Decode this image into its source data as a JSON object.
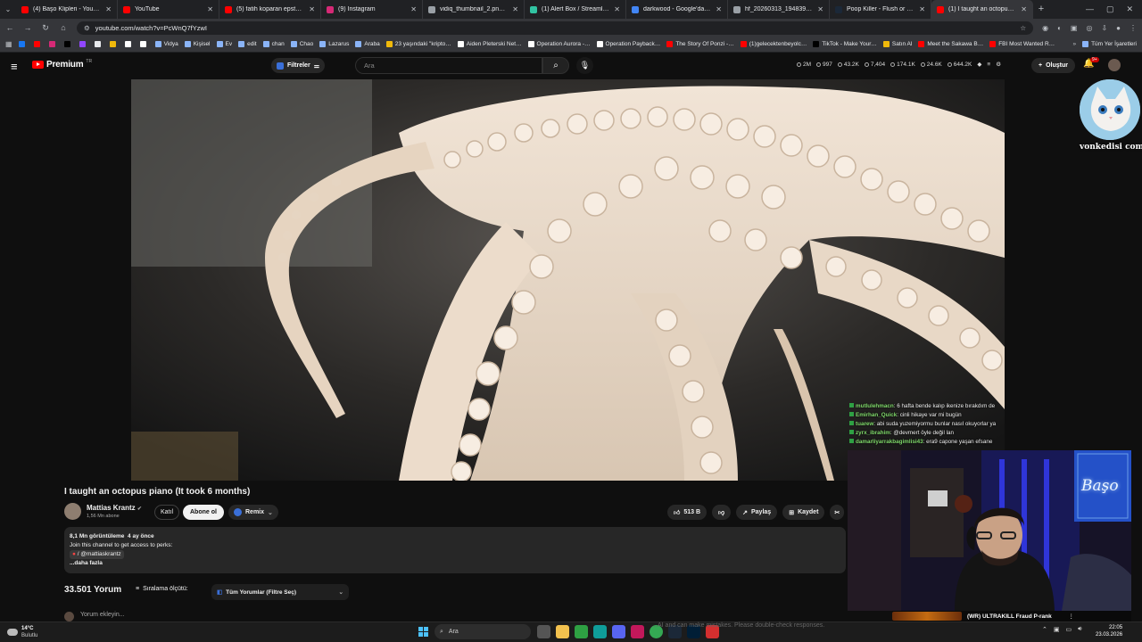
{
  "browser": {
    "tabs": [
      {
        "title": "(4) Başo Klipleri - YouTube",
        "color": "#ff0000"
      },
      {
        "title": "YouTube",
        "color": "#ff0000"
      },
      {
        "title": "(5) fatih koparan epstein adası",
        "color": "#ff0000"
      },
      {
        "title": "(9) Instagram",
        "color": "#d62976"
      },
      {
        "title": "vidiq_thumbnail_2.png (1280×…",
        "color": "#9aa0a6"
      },
      {
        "title": "(1) Alert Box / Streamlabs",
        "color": "#31c3a2"
      },
      {
        "title": "darkwood - Google'da Ara",
        "color": "#4285f4"
      },
      {
        "title": "hf_20260313_194839_41e0a9…",
        "color": "#9aa0a6"
      },
      {
        "title": "Poop Killer - Flush or Die Steam",
        "color": "#1b2838"
      },
      {
        "title": "(1) I taught an octopus piano",
        "color": "#ff0000"
      }
    ],
    "url": "youtube.com/watch?v=PcWnQ7fYzwI",
    "bookmarks": [
      {
        "label": "",
        "color": "#1877f2"
      },
      {
        "label": "",
        "color": "#ff0000"
      },
      {
        "label": "",
        "color": "#d62976"
      },
      {
        "label": "",
        "color": "#000000"
      },
      {
        "label": "",
        "color": "#9146ff"
      },
      {
        "label": "",
        "color": "#e8eaed"
      },
      {
        "label": "",
        "color": "#f0b90b"
      },
      {
        "label": "",
        "color": "#ffffff"
      },
      {
        "label": "",
        "color": "#ffffff"
      },
      {
        "label": "Vidya",
        "color": "#8ab4f8"
      },
      {
        "label": "Kişisel",
        "color": "#8ab4f8"
      },
      {
        "label": "Ev",
        "color": "#8ab4f8"
      },
      {
        "label": "edit",
        "color": "#8ab4f8"
      },
      {
        "label": "chan",
        "color": "#8ab4f8"
      },
      {
        "label": "Chao",
        "color": "#8ab4f8"
      },
      {
        "label": "Lazarus",
        "color": "#8ab4f8"
      },
      {
        "label": "Araba",
        "color": "#8ab4f8"
      },
      {
        "label": "23 yaşındaki \"kripto…",
        "color": "#f0b90b"
      },
      {
        "label": "Aiden Pleterski Net…",
        "color": "#ffffff"
      },
      {
        "label": "Operation Aurora -…",
        "color": "#ffffff"
      },
      {
        "label": "Operation Payback…",
        "color": "#ffffff"
      },
      {
        "label": "The Story Of Ponzi -…",
        "color": "#ff0000"
      },
      {
        "label": "(1)gelecektenbeyolc…",
        "color": "#ff0000"
      },
      {
        "label": "TikTok - Make Your…",
        "color": "#000000"
      },
      {
        "label": "Satın Al",
        "color": "#f0b90b"
      },
      {
        "label": "Meet the Sakawa B…",
        "color": "#ff0000"
      },
      {
        "label": "FBI Most Wanted R…",
        "color": "#ff0000"
      }
    ],
    "all_bookmarks": "Tüm Yer İşaretleri"
  },
  "youtube": {
    "logo_text": "Premium",
    "logo_country": "TR",
    "filters_label": "Filtreler",
    "search_placeholder": "Ara",
    "stats": [
      "2M",
      "997",
      "43.2K",
      "7,404",
      "174.1K",
      "24.6K",
      "644.2K"
    ],
    "create_label": "Oluştur",
    "notif_count": "9+"
  },
  "video": {
    "title": "I taught an octopus piano (It took 6 months)",
    "channel": "Mattias Krantz",
    "subscribers": "1,56 Mn abone",
    "join_label": "Katıl",
    "subscribe_label": "Abone ol",
    "remix_label": "Remix",
    "likes": "513 B",
    "share_label": "Paylaş",
    "save_label": "Kaydet",
    "description": {
      "views": "8,1 Mn görüntüleme",
      "age": "4 ay önce",
      "line1": "Join this channel to get access to perks:",
      "handle": "/ @mattiaskrantz",
      "more": "...daha fazla"
    }
  },
  "comments": {
    "count": "33.501 Yorum",
    "sort_label": "Sıralama ölçütü:",
    "filter_label": "Tüm Yorumlar (Filtre Seç)",
    "input_placeholder": "Yorum ekleyin..."
  },
  "stream": {
    "cat_label": "vonkedisi com",
    "chat": [
      {
        "user": "mutlulehmacn",
        "msg": "6 hafta bende kalıp ikenize bırakdım de"
      },
      {
        "user": "Emirhan_Quick",
        "msg": "cinli hikaye var mi bugün"
      },
      {
        "user": "tuarew",
        "msg": "abi suda yuzemiyormu bunlar nasıl okuyorlar ya"
      },
      {
        "user": "zyrx_ibrahim",
        "msg": "@devmert öyle değil lan"
      },
      {
        "user": "damarliyarrakbagimlisi43",
        "msg": "era9 capone yaşan efsane"
      }
    ],
    "neon_sign": "Başo",
    "banner_text": "(WR) ULTRAKILL Fraud P-rank",
    "ghost_text": "…AI and can make mistakes. Please double-check responses."
  },
  "taskbar": {
    "temp": "14°C",
    "weather": "Bulutlu",
    "search": "Ara",
    "time": "22:05",
    "date": "23.03.2026"
  }
}
